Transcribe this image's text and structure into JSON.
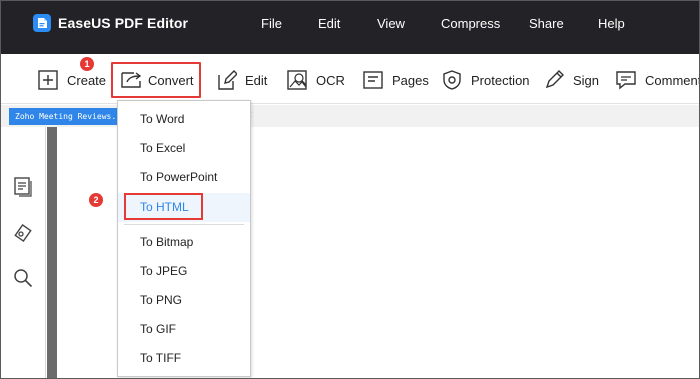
{
  "app": {
    "title": "EaseUS PDF Editor"
  },
  "menu": [
    "File",
    "Edit",
    "View",
    "Compress",
    "Share",
    "Help"
  ],
  "toolbar": {
    "create": "Create",
    "convert": "Convert",
    "edit": "Edit",
    "ocr": "OCR",
    "pages": "Pages",
    "protection": "Protection",
    "sign": "Sign",
    "comment": "Comment"
  },
  "document_tab": {
    "label": "Zoho Meeting Reviews..."
  },
  "convert_menu": {
    "items": [
      "To Word",
      "To Excel",
      "To PowerPoint",
      "To HTML",
      "To Bitmap",
      "To JPEG",
      "To PNG",
      "To GIF",
      "To TIFF"
    ],
    "highlighted": "To HTML"
  },
  "badges": {
    "step1": "1",
    "step2": "2"
  },
  "colors": {
    "titlebar": "#232327",
    "accent": "#2f86e8",
    "annotation": "#e53935",
    "canvas": "#6b6b6b"
  }
}
